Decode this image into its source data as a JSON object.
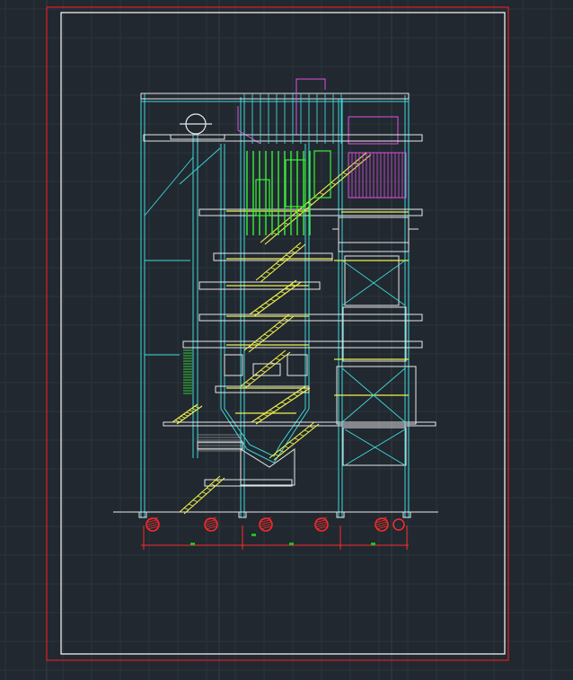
{
  "viewport": {
    "name": "cad-model-space",
    "background_color": "#212830",
    "grid_color": "#2b333d",
    "grid_major_color": "#323b46"
  },
  "sheet": {
    "outer_border_color": "#e01e1e",
    "inner_border_color": "#ffffff"
  },
  "drawing": {
    "title": "",
    "layer_colors": {
      "structure": "#3fd8d8",
      "frame_white": "#e8e8e8",
      "walkway": "#f2f24a",
      "pipes": "#39f039",
      "ducts": "#e052e0",
      "dimensions": "#ff2a2a",
      "markers": "#1fbf1f"
    },
    "foundation_marker_count": 6,
    "columns": 6
  }
}
